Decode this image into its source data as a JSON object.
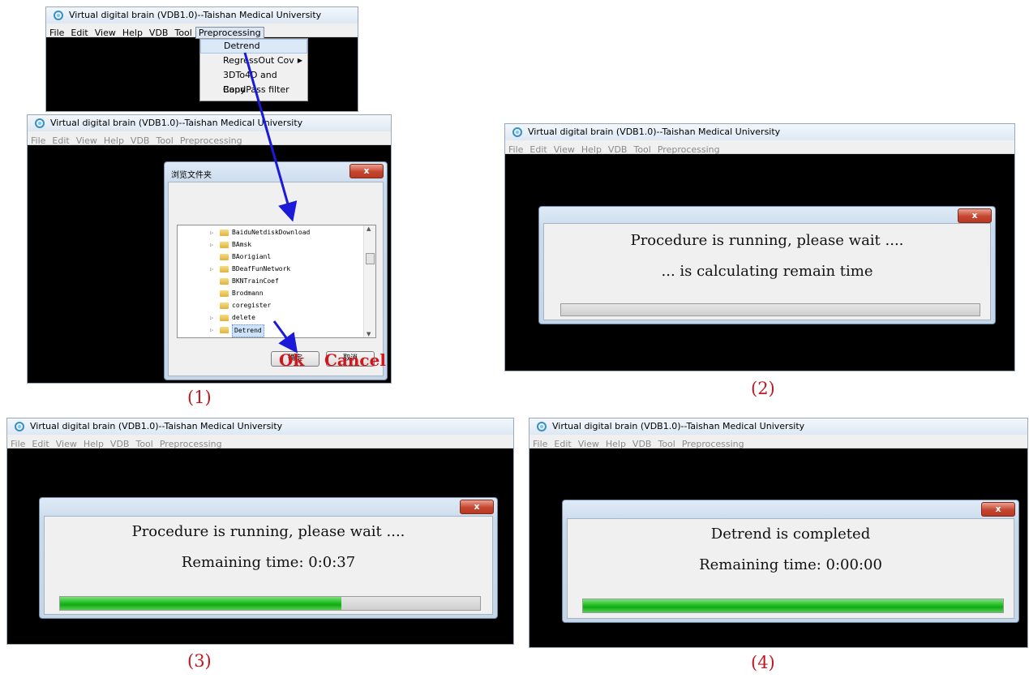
{
  "app": {
    "window_title": "Virtual digital brain (VDB1.0)--Taishan Medical University",
    "menu": [
      "File",
      "Edit",
      "View",
      "Help",
      "VDB",
      "Tool",
      "Preprocessing"
    ]
  },
  "panel1": {
    "caption": "(1)",
    "dropdown_items": [
      {
        "label": "Detrend"
      },
      {
        "label": "RegressOut Cov",
        "submenu": true
      },
      {
        "label": "3DTo4D and Copy"
      },
      {
        "label": "BandPass filter"
      }
    ],
    "browse_dialog": {
      "title": "浏览文件夹",
      "folders": [
        "BaiduNetdiskDownload",
        "BAmsk",
        "BAorigianl",
        "BDeafFunNetwork",
        "BKNTrainCoef",
        "Brodmann",
        "coregister",
        "delete",
        "Detrend"
      ],
      "ok_button": "确定",
      "cancel_button": "取消",
      "ok_annotation": "Ok",
      "cancel_annotation": "Cancel"
    }
  },
  "panel2": {
    "caption": "(2)",
    "line1": "Procedure is running, please wait ....",
    "line2": "... is calculating remain time",
    "progress": 0
  },
  "panel3": {
    "caption": "(3)",
    "line1": "Procedure is running, please wait ....",
    "line2": "Remaining time: 0:0:37",
    "progress": 0.67
  },
  "panel4": {
    "caption": "(4)",
    "line1": "Detrend is completed",
    "line2": "Remaining time: 0:00:00",
    "progress": 1.0
  },
  "colors": {
    "progress_green": "#1fbf1f",
    "caption_red": "#c0181f",
    "arrow_blue": "#1a1ad8"
  }
}
